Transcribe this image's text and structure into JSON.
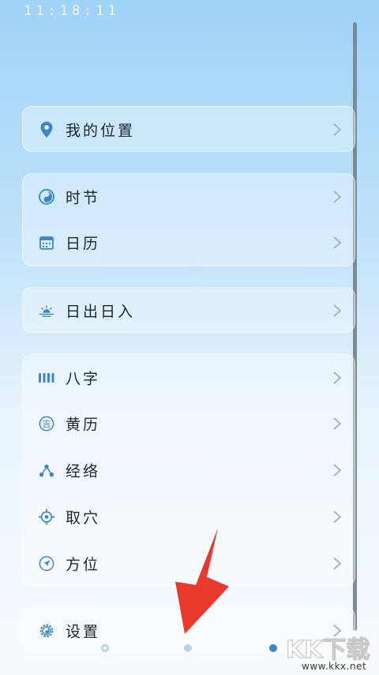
{
  "status": {
    "time": "11:18:11"
  },
  "location": {
    "label": "我的位置"
  },
  "group_time": [
    {
      "label": "时节",
      "icon": "yin-yang-icon"
    },
    {
      "label": "日历",
      "icon": "calendar-icon"
    }
  ],
  "sun": {
    "label": "日出日入",
    "icon": "sunrise-icon"
  },
  "group_tools": [
    {
      "label": "八字",
      "icon": "bars-icon"
    },
    {
      "label": "黄历",
      "icon": "ji-circle-icon",
      "glyph": "吉"
    },
    {
      "label": "经络",
      "icon": "meridian-nodes-icon"
    },
    {
      "label": "取穴",
      "icon": "crosshair-icon"
    },
    {
      "label": "方位",
      "icon": "compass-arrow-icon"
    }
  ],
  "settings": {
    "label": "设置",
    "icon": "gear-icon"
  },
  "pager": {
    "count": 3,
    "active_index": 2
  },
  "watermark": {
    "brand": "KK下载",
    "url": "www.kkx.net"
  },
  "colors": {
    "accent": "#3a86c8",
    "arrow": "#e8392b"
  }
}
